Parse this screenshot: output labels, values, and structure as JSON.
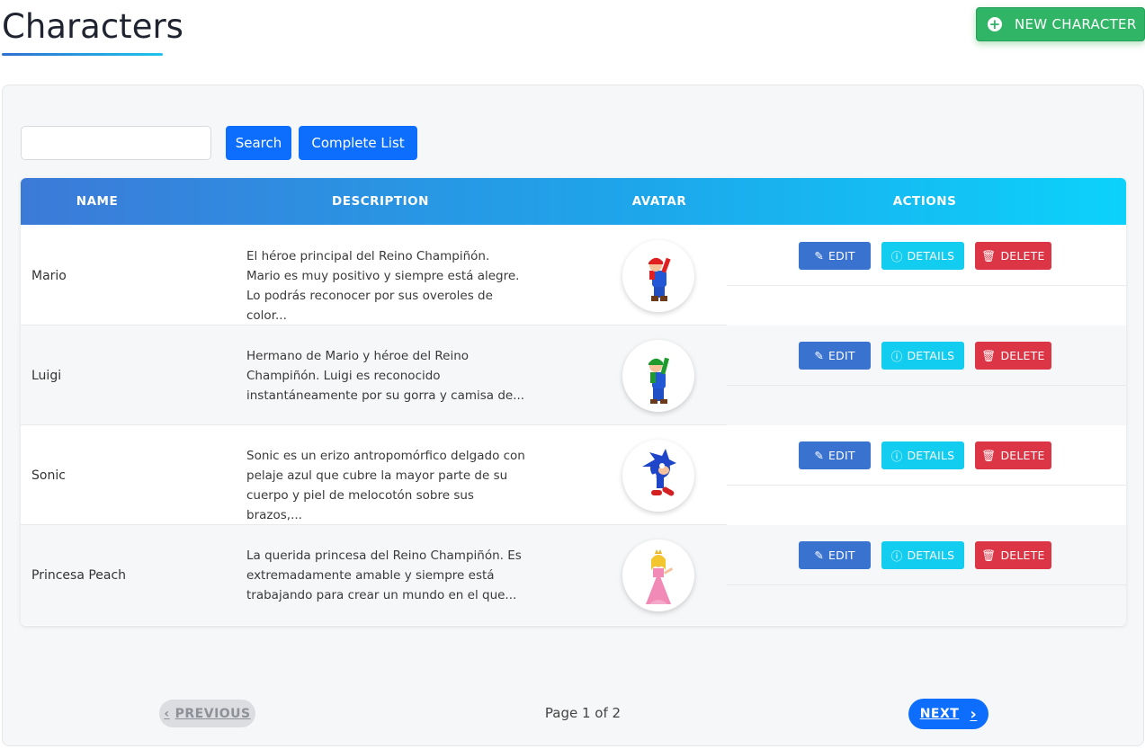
{
  "header": {
    "title": "Characters",
    "new_button_label": "NEW CHARACTER"
  },
  "search": {
    "value": "",
    "placeholder": "",
    "search_label": "Search",
    "complete_label": "Complete List"
  },
  "table": {
    "columns": [
      "NAME",
      "DESCRIPTION",
      "AVATAR",
      "ACTIONS"
    ],
    "rows": [
      {
        "name": "Mario",
        "description": "El héroe principal del Reino Champiñón. Mario es muy positivo y siempre está alegre. Lo podrás reconocer por sus overoles de color...",
        "avatar": "mario-avatar"
      },
      {
        "name": "Luigi",
        "description": "Hermano de Mario y héroe del Reino Champiñón. Luigi es reconocido instantáneamente por su gorra y camisa de...",
        "avatar": "luigi-avatar"
      },
      {
        "name": "Sonic",
        "description": "Sonic es un erizo antropomórfico delgado con pelaje azul que cubre la mayor parte de su cuerpo y piel de melocotón sobre sus brazos,...",
        "avatar": "sonic-avatar"
      },
      {
        "name": "Princesa Peach",
        "description": "La querida princesa del Reino Champiñón. Es extremadamente amable y siempre está trabajando para crear un mundo en el que...",
        "avatar": "peach-avatar"
      }
    ],
    "actions": {
      "edit_label": "EDIT",
      "details_label": "DETAILS",
      "delete_label": "DELETE"
    }
  },
  "pagination": {
    "previous_label": "PREVIOUS",
    "page_info": "Page 1 of 2",
    "next_label": "NEXT"
  },
  "colors": {
    "primary": "#0d6efd",
    "success": "#2fb565",
    "info": "#12cdf0",
    "danger": "#dc3545",
    "edit": "#3a73cf"
  }
}
